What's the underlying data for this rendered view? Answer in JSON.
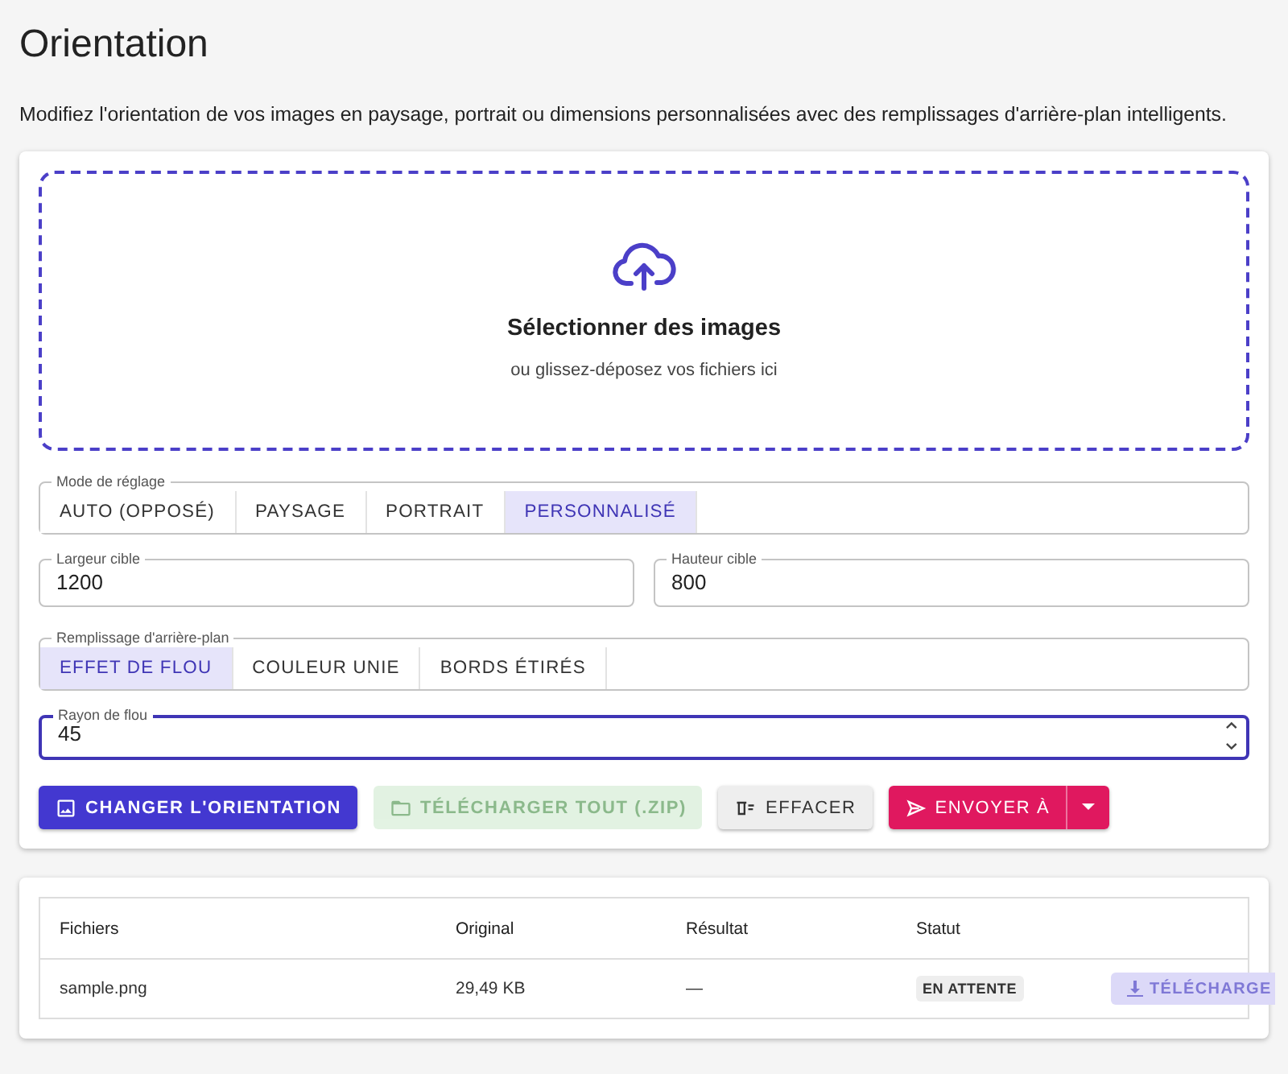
{
  "title": "Orientation",
  "description": "Modifiez l'orientation de vos images en paysage, portrait ou dimensions personnalisées avec des remplissages d'arrière-plan intelligents.",
  "dropzone": {
    "title": "Sélectionner des images",
    "hint": "ou glissez-déposez vos fichiers ici"
  },
  "mode": {
    "label": "Mode de réglage",
    "options": [
      {
        "label": "AUTO (OPPOSÉ)",
        "selected": false
      },
      {
        "label": "PAYSAGE",
        "selected": false
      },
      {
        "label": "PORTRAIT",
        "selected": false
      },
      {
        "label": "PERSONNALISÉ",
        "selected": true
      }
    ]
  },
  "target_width": {
    "label": "Largeur cible",
    "value": "1200"
  },
  "target_height": {
    "label": "Hauteur cible",
    "value": "800"
  },
  "background_fill": {
    "label": "Remplissage d'arrière-plan",
    "options": [
      {
        "label": "EFFET DE FLOU",
        "selected": true
      },
      {
        "label": "COULEUR UNIE",
        "selected": false
      },
      {
        "label": "BORDS ÉTIRÉS",
        "selected": false
      }
    ]
  },
  "blur_radius": {
    "label": "Rayon de flou",
    "value": "45",
    "focused": true
  },
  "actions": [
    {
      "kind": "primary",
      "label": "CHANGER L'ORIENTATION",
      "disabled": false
    },
    {
      "kind": "success",
      "label": "TÉLÉCHARGER TOUT (.ZIP)",
      "disabled": true
    },
    {
      "kind": "neutral",
      "label": "EFFACER",
      "disabled": false
    },
    {
      "kind": "split",
      "label": "ENVOYER À",
      "disabled": false
    }
  ],
  "table": {
    "columns": [
      "Fichiers",
      "Original",
      "Résultat",
      "Statut"
    ],
    "rows": [
      {
        "file": "sample.png",
        "original": "29,49 KB",
        "result": "—",
        "status": "EN ATTENTE",
        "download": {
          "label": "TÉLÉCHARGE",
          "disabled": true
        }
      }
    ]
  }
}
